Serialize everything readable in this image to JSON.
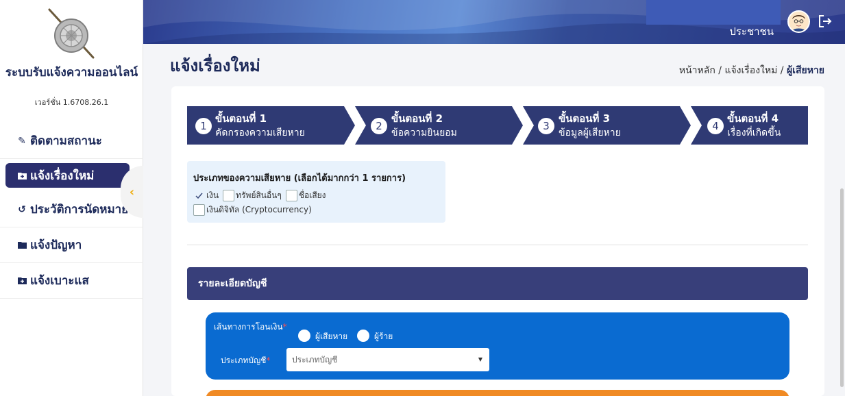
{
  "app": {
    "title": "ระบบรับแจ้งความออนไลน์",
    "version": "เวอร์ชั่น 1.6708.26.1"
  },
  "sidebar": {
    "items": [
      {
        "label": "ติดตามสถานะ",
        "icon": "edit-icon"
      },
      {
        "label": "แจ้งเรื่องใหม่",
        "icon": "folder-plus-icon",
        "active": true
      },
      {
        "label": "ประวัติการนัดหมาย",
        "icon": "history-icon"
      },
      {
        "label": "แจ้งปัญหา",
        "icon": "folder-icon"
      },
      {
        "label": "แจ้งเบาะแส",
        "icon": "folder-plus-icon"
      }
    ],
    "collapse_icon": "chevron-left-icon"
  },
  "header": {
    "user_name": "ประชาชน",
    "avatar_icon": "user-avatar-icon",
    "logout_icon": "logout-icon",
    "colors": {
      "primary": "#2b3c8e",
      "accent": "#5b89d4"
    }
  },
  "page": {
    "title": "แจ้งเรื่องใหม่",
    "breadcrumb": {
      "home": "หน้าหลัก",
      "sep1": " / ",
      "parent": "แจ้งเรื่องใหม่",
      "sep2": " / ",
      "current": "ผู้เสียหาย"
    }
  },
  "steps": [
    {
      "num": "1",
      "title": "ขั้นตอนที่ 1",
      "subtitle": "คัดกรองความเสียหาย"
    },
    {
      "num": "2",
      "title": "ขั้นตอนที่ 2",
      "subtitle": "ข้อความยินยอม"
    },
    {
      "num": "3",
      "title": "ขั้นตอนที่ 3",
      "subtitle": "ข้อมูลผู้เสียหาย"
    },
    {
      "num": "4",
      "title": "ขั้นตอนที่ 4",
      "subtitle": "เรื่องที่เกิดขึ้น"
    }
  ],
  "damage": {
    "title": "ประเภทของความเสียหาย (เลือกได้มากกว่า 1 รายการ)",
    "options": [
      {
        "label": "เงิน",
        "checked": true
      },
      {
        "label": "ทรัพย์สินอื่นๆ",
        "checked": false
      },
      {
        "label": "ชื่อเสียง",
        "checked": false
      },
      {
        "label": "เงินดิจิทัล (Cryptocurrency)",
        "checked": false
      }
    ]
  },
  "account_section": {
    "title": "รายละเอียดบัญชี",
    "transfer_route_label": "เส้นทางการโอนเงิน",
    "required_mark": "*",
    "radio_options": [
      "ผู้เสียหาย",
      "ผู้ร้าย"
    ],
    "account_type_label": "ประเภทบัญชี",
    "account_type_placeholder": "ประเภทบัญชี",
    "caret": "▼"
  },
  "colors": {
    "step_bg": "#2f3a74",
    "section_head": "#383f7a",
    "blue_panel": "#0a6bd1",
    "orange_panel": "#f08a24"
  }
}
